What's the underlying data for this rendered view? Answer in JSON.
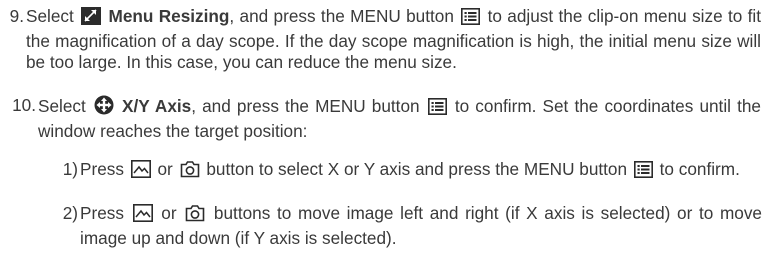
{
  "steps": [
    {
      "number": "9.",
      "before_icon": "Select",
      "icon": "menu-resize-icon",
      "bold_label": "Menu Resizing",
      "middle": ", and press the MENU button",
      "menu_icon": "menu-list-icon",
      "after": "to adjust the clip-on menu size to fit the magnification of a day scope. If the day scope magnification is high, the initial menu size will be too large. In this case, you can reduce the menu size."
    },
    {
      "number": "10.",
      "before_icon": "Select",
      "icon": "crosshair-move-icon",
      "bold_label": "X/Y Axis",
      "middle": ", and press the MENU button",
      "menu_icon": "menu-list-icon",
      "after": "to confirm. Set the coordinates until the window reaches the target position:"
    }
  ],
  "substeps": [
    {
      "number": "1)",
      "press": "Press",
      "or": "or",
      "text": "button to select X or Y axis and press the MENU button",
      "end": "to confirm."
    },
    {
      "number": "2)",
      "press": "Press",
      "or": "or",
      "text": "buttons to move image left and right (if X axis is selected) or to move image up and down (if Y axis is selected)."
    }
  ],
  "colors": {
    "text": "#3a3a3a",
    "icon_bg": "#2b2b2b"
  }
}
